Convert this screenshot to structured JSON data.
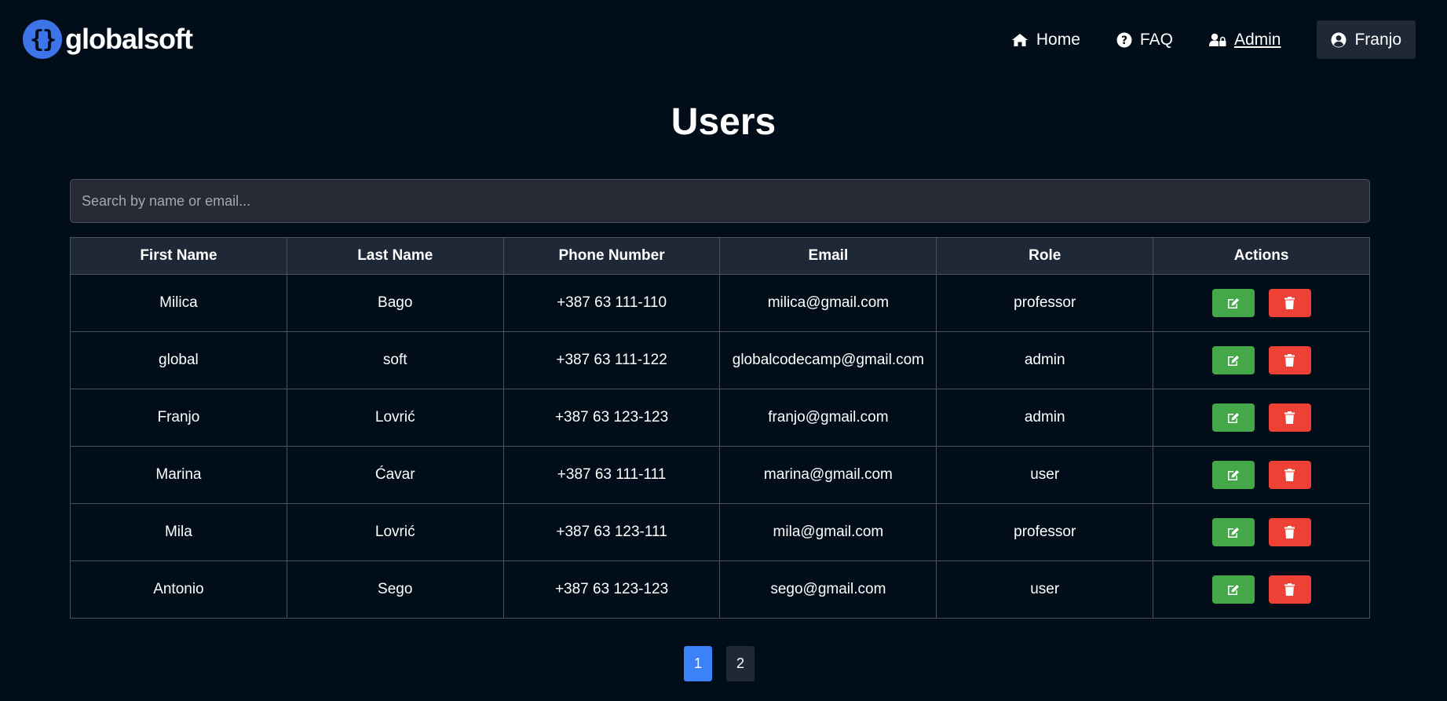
{
  "brand": {
    "logo_glyph": "{}",
    "name": "globalsoft"
  },
  "nav": {
    "home": "Home",
    "faq": "FAQ",
    "admin": "Admin",
    "user": "Franjo"
  },
  "page": {
    "title": "Users"
  },
  "search": {
    "placeholder": "Search by name or email...",
    "value": ""
  },
  "table": {
    "headers": [
      "First Name",
      "Last Name",
      "Phone Number",
      "Email",
      "Role",
      "Actions"
    ],
    "rows": [
      {
        "first": "Milica",
        "last": "Bago",
        "phone": "+387 63 111-110",
        "email": "milica@gmail.com",
        "role": "professor"
      },
      {
        "first": "global",
        "last": "soft",
        "phone": "+387 63 111-122",
        "email": "globalcodecamp@gmail.com",
        "role": "admin"
      },
      {
        "first": "Franjo",
        "last": "Lovrić",
        "phone": "+387 63 123-123",
        "email": "franjo@gmail.com",
        "role": "admin"
      },
      {
        "first": "Marina",
        "last": "Ćavar",
        "phone": "+387 63 111-111",
        "email": "marina@gmail.com",
        "role": "user"
      },
      {
        "first": "Mila",
        "last": "Lovrić",
        "phone": "+387 63 123-111",
        "email": "mila@gmail.com",
        "role": "professor"
      },
      {
        "first": "Antonio",
        "last": "Sego",
        "phone": "+387 63 123-123",
        "email": "sego@gmail.com",
        "role": "user"
      }
    ]
  },
  "pagination": {
    "pages": [
      "1",
      "2"
    ],
    "current": "1"
  },
  "colors": {
    "background": "#020d1a",
    "header_bg": "#1f2836",
    "accent": "#3b82f6",
    "edit": "#45a848",
    "delete": "#ee4136"
  },
  "icons": {
    "home": "home-icon",
    "faq": "question-circle-icon",
    "admin": "user-lock-icon",
    "user": "user-circle-icon",
    "edit": "edit-icon",
    "delete": "trash-icon"
  }
}
